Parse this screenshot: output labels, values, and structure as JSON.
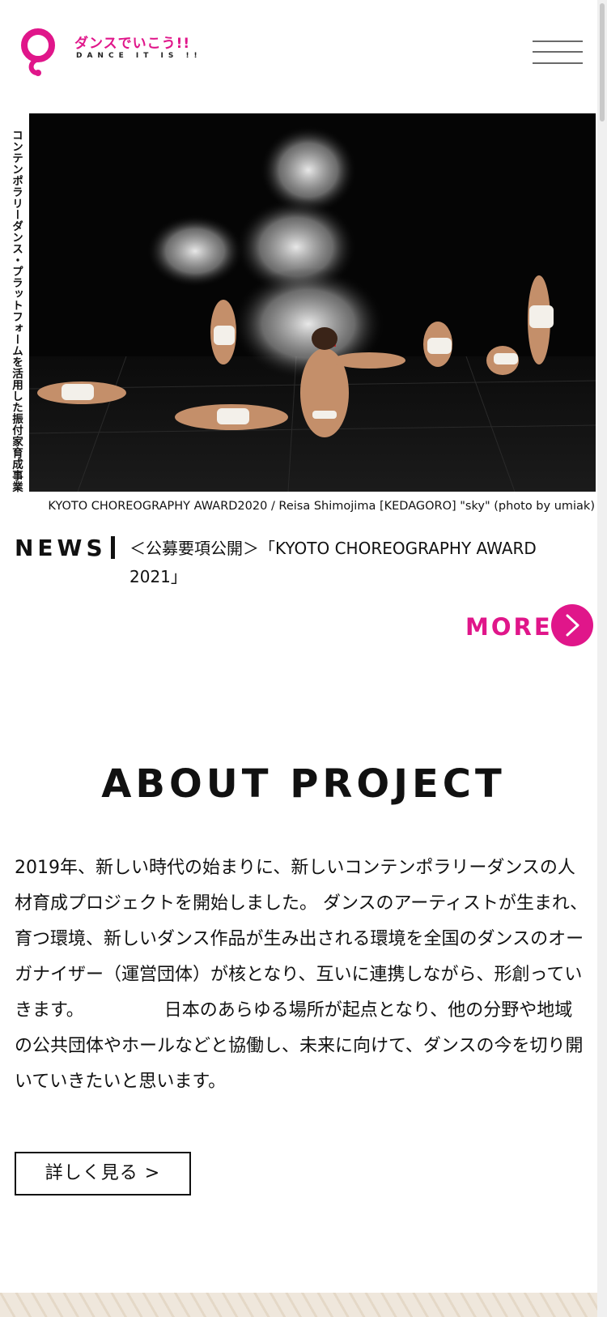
{
  "brand": {
    "name_jp": "ダンスでいこう!!",
    "name_en": "DANCE IT IS !!",
    "accent_color": "#e0168a"
  },
  "header": {
    "menu_icon": "hamburger-menu-icon"
  },
  "hero": {
    "vertical_caption": "コンテンポラリーダンス・プラットフォームを活用した振付家育成事業",
    "photo_credit": "KYOTO CHOREOGRAPHY AWARD2020 / Reisa Shimojima [KEDAGORO] \"sky\" (photo by umiak)"
  },
  "news": {
    "label": "NEWS",
    "headline": "＜公募要項公開＞「KYOTO CHOREOGRAPHY AWARD 2021」",
    "more_label": "MORE",
    "more_icon": "arrow-right-icon"
  },
  "about": {
    "title": "ABOUT PROJECT",
    "body": "2019年、新しい時代の始まりに、新しいコンテンポラリーダンスの人材育成プロジェクトを開始しました。 ダンスのアーティストが生まれ、育つ環境、新しいダンス作品が生み出される環境を全国のダンスのオーガナイザー（運営団体）が核となり、互いに連携しながら、形創っていきます。　　　　　日本のあらゆる場所が起点となり、他の分野や地域の公共団体やホールなどと協働し、未来に向けて、ダンスの今を切り開いていきたいと思います。",
    "detail_label": "詳しく見る >"
  }
}
